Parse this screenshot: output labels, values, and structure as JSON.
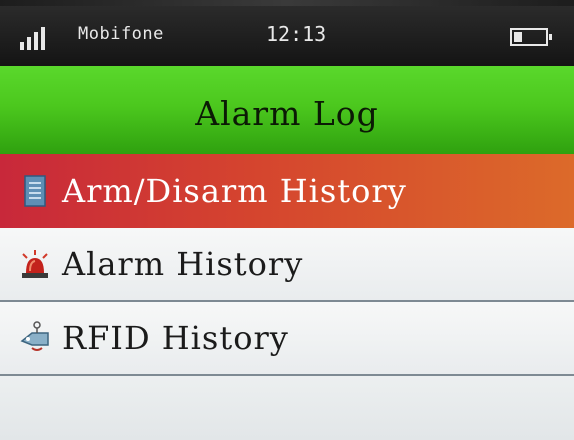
{
  "status_bar": {
    "carrier": "Mobifone",
    "time": "12:13",
    "signal_icon": "signal-bars-icon",
    "battery_icon": "battery-icon"
  },
  "title": "Alarm Log",
  "menu": {
    "items": [
      {
        "label": "Arm/Disarm History",
        "icon": "document-icon",
        "selected": true
      },
      {
        "label": "Alarm History",
        "icon": "alarm-siren-icon",
        "selected": false
      },
      {
        "label": "RFID History",
        "icon": "rfid-tag-icon",
        "selected": false
      }
    ]
  },
  "colors": {
    "title_bar": "#4cc81e",
    "selected_item_start": "#c8283a",
    "selected_item_end": "#dc6a2a",
    "status_bar": "#1e1e1e"
  }
}
